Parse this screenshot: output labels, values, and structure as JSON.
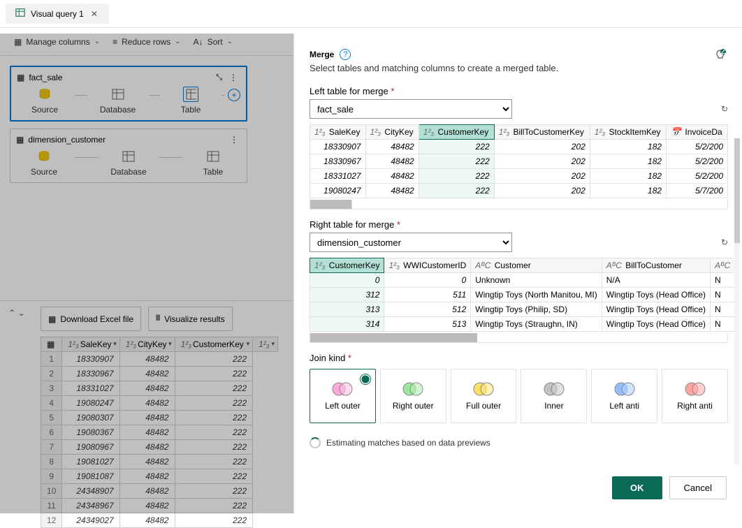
{
  "tab": {
    "label": "Visual query 1"
  },
  "toolbar": {
    "manage": "Manage columns",
    "reduce": "Reduce rows",
    "sort": "Sort"
  },
  "cards": [
    {
      "title": "fact_sale",
      "nodes": [
        "Source",
        "Database",
        "Table"
      ],
      "selected": true
    },
    {
      "title": "dimension_customer",
      "nodes": [
        "Source",
        "Database",
        "Table"
      ],
      "selected": false
    }
  ],
  "gridBtns": {
    "download": "Download Excel file",
    "viz": "Visualize results"
  },
  "gridCols": [
    "SaleKey",
    "CityKey",
    "CustomerKey",
    ""
  ],
  "gridRows": [
    [
      "1",
      "18330907",
      "48482",
      "222"
    ],
    [
      "2",
      "18330967",
      "48482",
      "222"
    ],
    [
      "3",
      "18331027",
      "48482",
      "222"
    ],
    [
      "4",
      "19080247",
      "48482",
      "222"
    ],
    [
      "5",
      "19080307",
      "48482",
      "222"
    ],
    [
      "6",
      "19080367",
      "48482",
      "222"
    ],
    [
      "7",
      "19080967",
      "48482",
      "222"
    ],
    [
      "8",
      "19081027",
      "48482",
      "222"
    ],
    [
      "9",
      "19081087",
      "48482",
      "222"
    ],
    [
      "10",
      "24348907",
      "48482",
      "222"
    ],
    [
      "11",
      "24348967",
      "48482",
      "222"
    ],
    [
      "12",
      "24349027",
      "48482",
      "222"
    ]
  ],
  "dialog": {
    "title": "Merge",
    "desc": "Select tables and matching columns to create a merged table.",
    "leftLbl": "Left table for merge",
    "leftVal": "fact_sale",
    "rightLbl": "Right table for merge",
    "rightVal": "dimension_customer",
    "leftCols": [
      "SaleKey",
      "CityKey",
      "CustomerKey",
      "BillToCustomerKey",
      "StockItemKey",
      "InvoiceDa"
    ],
    "leftRows": [
      [
        "18330907",
        "48482",
        "222",
        "202",
        "182",
        "5/2/200"
      ],
      [
        "18330967",
        "48482",
        "222",
        "202",
        "182",
        "5/2/200"
      ],
      [
        "18331027",
        "48482",
        "222",
        "202",
        "182",
        "5/2/200"
      ],
      [
        "19080247",
        "48482",
        "222",
        "202",
        "182",
        "5/7/200"
      ]
    ],
    "rightCols": [
      "CustomerKey",
      "WWICustomerID",
      "Customer",
      "BillToCustomer",
      ""
    ],
    "rightRows": [
      [
        "0",
        "0",
        "Unknown",
        "N/A",
        "N"
      ],
      [
        "312",
        "511",
        "Wingtip Toys (North Manitou, MI)",
        "Wingtip Toys (Head Office)",
        "N"
      ],
      [
        "313",
        "512",
        "Wingtip Toys (Philip, SD)",
        "Wingtip Toys (Head Office)",
        "N"
      ],
      [
        "314",
        "513",
        "Wingtip Toys (Straughn, IN)",
        "Wingtip Toys (Head Office)",
        "N"
      ]
    ],
    "joinLbl": "Join kind",
    "joins": [
      "Left outer",
      "Right outer",
      "Full outer",
      "Inner",
      "Left anti",
      "Right anti"
    ],
    "estim": "Estimating matches based on data previews",
    "ok": "OK",
    "cancel": "Cancel"
  }
}
